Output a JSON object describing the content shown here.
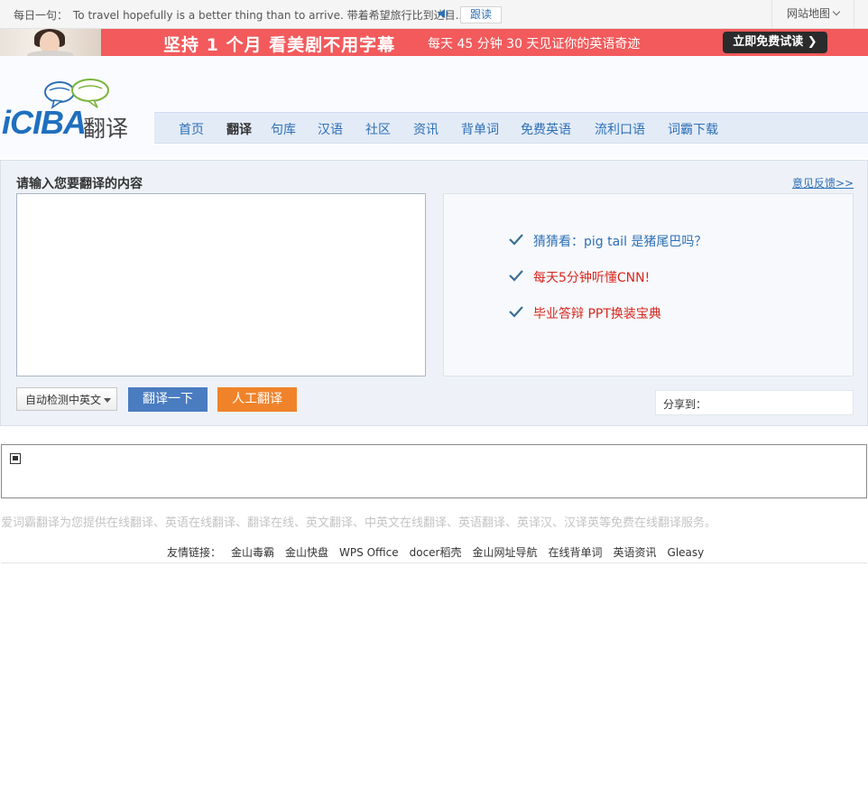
{
  "topbar": {
    "daily_label": "每日一句：",
    "daily_text": "To travel hopefully is a better thing than to arrive. 带着希望旅行比到达目...",
    "speaker_icon": "speaker-icon",
    "follow_button": "跟读",
    "sitemap": "网站地图"
  },
  "banner": {
    "headline": "坚持 1 个月  看美剧不用字幕",
    "subtext": "每天 45 分钟  30 天见证你的英语奇迹",
    "cta": "立即免费试读 ❯",
    "color": "#f25a5c"
  },
  "header": {
    "logo_text": "iCIBA",
    "logo_cn": "翻译",
    "nav": [
      "首页",
      "翻译",
      "句库",
      "汉语",
      "社区",
      "资讯",
      "背单词",
      "免费英语",
      "流利口语",
      "词霸下载"
    ],
    "active_nav": "翻译"
  },
  "translate": {
    "title": "请输入您要翻译的内容",
    "feedback": "意见反馈>>",
    "input_value": "",
    "suggestions": [
      {
        "text": "猜猜看：pig tail 是猪尾巴吗？",
        "color": "#2d6fb6"
      },
      {
        "text": "每天5分钟听懂CNN!",
        "color": "#d8261d"
      },
      {
        "text": "毕业答辩  PPT换装宝典",
        "color": "#d8261d"
      }
    ],
    "language_select": "自动检测中英文",
    "translate_button": "翻译一下",
    "human_button": "人工翻译",
    "share_label": "分享到："
  },
  "footer": {
    "description": "爱词霸翻译为您提供在线翻译、英语在线翻译、翻译在线、英文翻译、中英文在线翻译、英语翻译、英译汉、汉译英等免费在线翻译服务。",
    "links_label": "友情链接：",
    "links": [
      "金山毒霸",
      "金山快盘",
      "WPS Office",
      "docer稻壳",
      "金山网址导航",
      "在线背单词",
      "英语资讯",
      "Gleasy"
    ]
  },
  "colors": {
    "link_blue": "#2d6fb6",
    "translate_button": "#4a7cc0",
    "human_button": "#f0832a",
    "check_green": "#3b6f95"
  }
}
